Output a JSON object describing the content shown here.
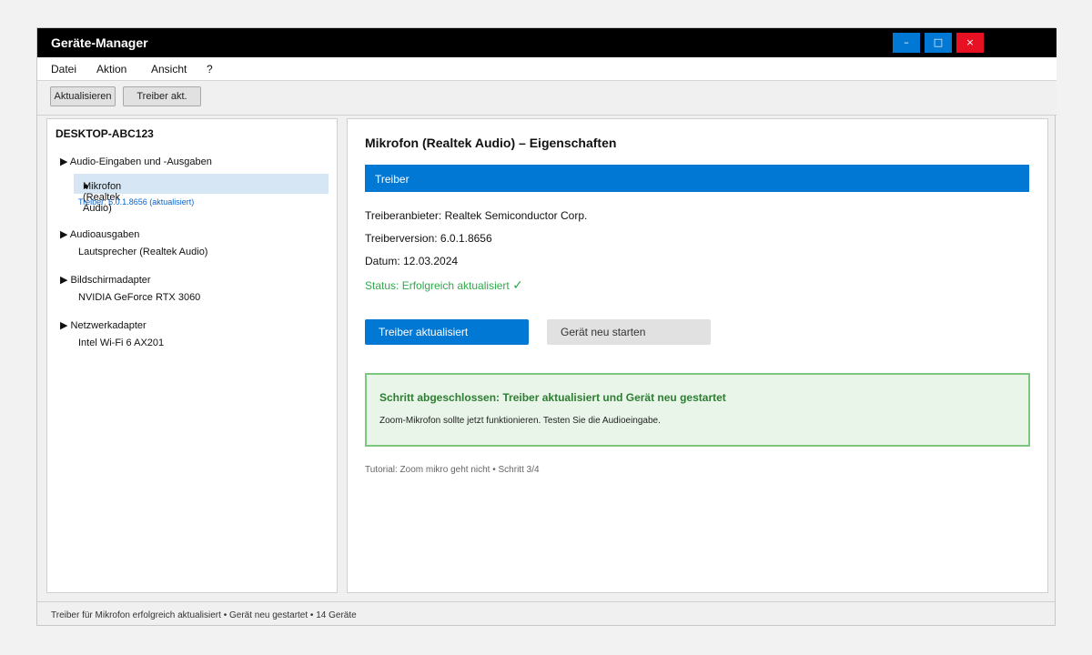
{
  "window": {
    "title": "Geräte-Manager",
    "minimize_glyph": "–",
    "maximize_glyph": "□",
    "close_glyph": "×"
  },
  "menu": [
    "Datei",
    "Aktion",
    "Ansicht",
    "?"
  ],
  "toolbar": {
    "refresh_label": "Aktualisieren",
    "update_driver_label": "Treiber akt."
  },
  "tree": {
    "root": "DESKTOP-ABC123",
    "expander_glyph": "▶",
    "selected_glyph": "●",
    "categories": [
      {
        "label": "Audio-Eingaben und -Ausgaben",
        "devices": [
          "Mikrofon (Realtek Audio)"
        ],
        "note": "Treiber: 6.0.1.8656 (aktualisiert)"
      },
      {
        "label": "Audioausgaben",
        "devices": [
          "Lautsprecher (Realtek Audio)"
        ]
      },
      {
        "label": "Bildschirmadapter",
        "devices": [
          "NVIDIA GeForce RTX 3060"
        ]
      },
      {
        "label": "Netzwerkadapter",
        "devices": [
          "Intel Wi-Fi 6 AX201"
        ]
      }
    ]
  },
  "detail": {
    "title": "Mikrofon (Realtek Audio) – Eigenschaften",
    "tab": "Treiber",
    "properties": [
      "Treiberanbieter: Realtek Semiconductor Corp.",
      "Treiberversion: 6.0.1.8656",
      "Datum: 12.03.2024"
    ],
    "status": "Status: Erfolgreich aktualisiert",
    "status_icon": "✓",
    "primary_button": "Treiber aktualisiert",
    "secondary_button": "Gerät neu starten",
    "success_title": "Schritt abgeschlossen: Treiber aktualisiert und Gerät neu gestartet",
    "success_body": "Zoom-Mikrofon sollte jetzt funktionieren. Testen Sie die Audioeingabe.",
    "tutorial": "Tutorial: Zoom mikro geht nicht • Schritt 3/4"
  },
  "statusbar": "Treiber für Mikrofon erfolgreich aktualisiert • Gerät neu gestartet • 14 Geräte",
  "colors": {
    "accent": "#0078d4",
    "close": "#e81123",
    "success_text": "#2e7d32",
    "status_green": "#2eaa4a",
    "selection": "#d6e6f5"
  }
}
